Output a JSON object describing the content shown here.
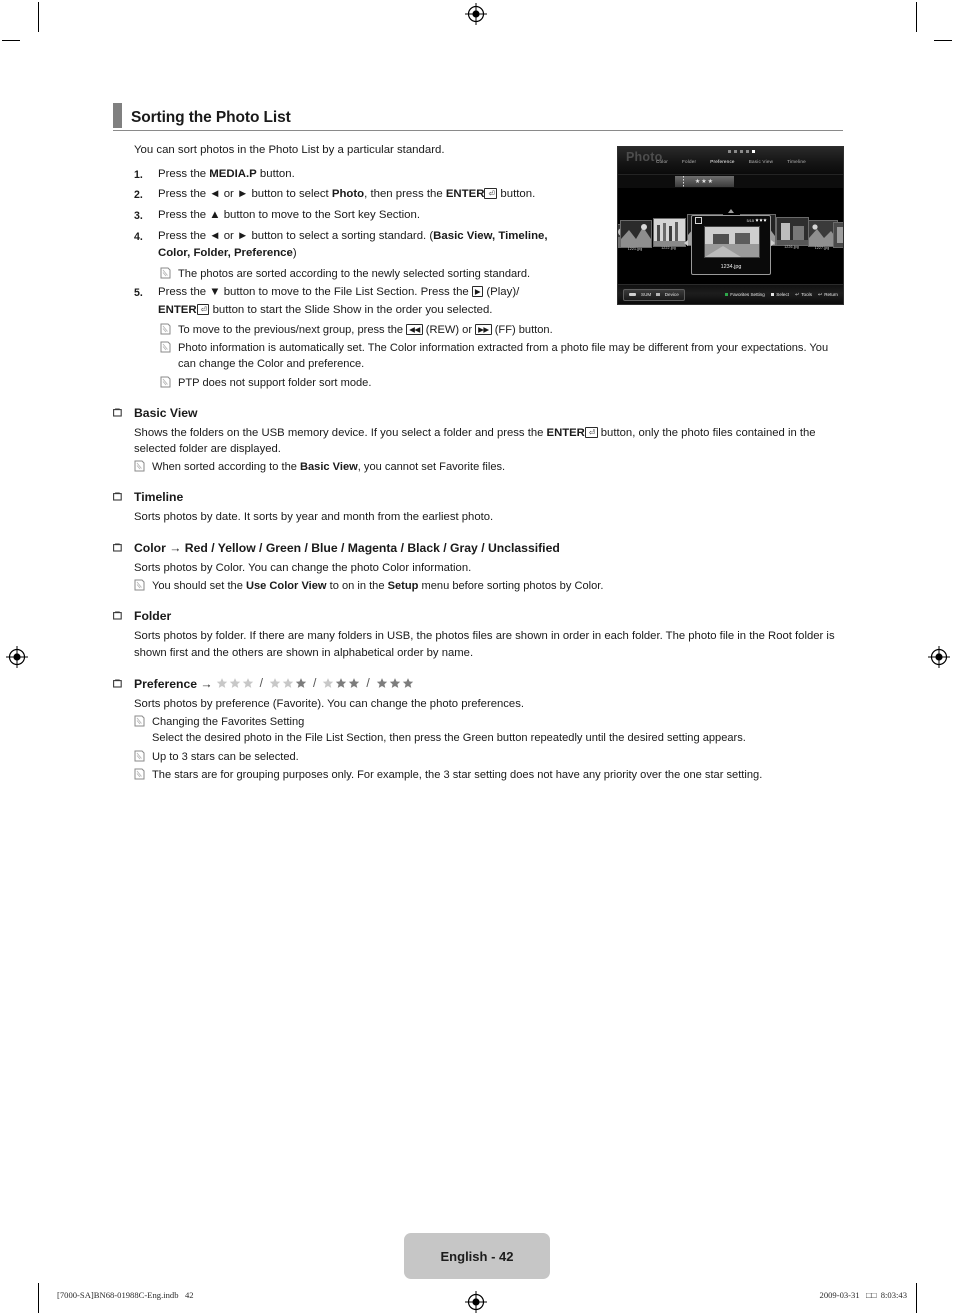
{
  "section": {
    "title": "Sorting the Photo List",
    "intro": "You can sort photos in the Photo List by a particular standard."
  },
  "steps": [
    {
      "num": "1.",
      "text_before": "Press the ",
      "bold": "MEDIA.P",
      "text_after": " button."
    },
    {
      "num": "2.",
      "text": "Press the ◄ or ► button to select Photo, then press the ENTER button."
    },
    {
      "num": "3.",
      "text": "Press the ▲ button to move to the Sort key Section."
    },
    {
      "num": "4.",
      "text": "Press the ◄ or ► button to select a sorting standard. (Basic View, Timeline, Color, Folder, Preference)"
    },
    {
      "num": "5.",
      "text": "Press the ▼ button to move to the File List Section. Press the (Play)/ENTER button to start the Slide Show in the order you selected."
    }
  ],
  "step_parts": {
    "s2_a": "Press the ◄ or ► button to select ",
    "s2_bold": "Photo",
    "s2_b": ", then press the ",
    "s2_enter": "ENTER",
    "s2_c": " button.",
    "s3": "Press the ▲ button to move to the Sort key Section.",
    "s4_a": "Press the ◄ or ► button to select a sorting standard. (",
    "s4_bold1": "Basic View, Timeline,",
    "s4_bold2": "Color, Folder, Preference",
    "s4_c": ")",
    "s5_a": "Press the ▼ button to move to the File List Section. Press the ",
    "s5_play": " (Play)/",
    "s5_enter": "ENTER",
    "s5_b": " button to start the Slide Show in the order you selected."
  },
  "notes": {
    "n_sorted": "The photos are sorted according to the newly selected sorting standard.",
    "n_group_a": "To move to the previous/next group, press the ",
    "n_group_rew": " (REW) or ",
    "n_group_ff": " (FF) button.",
    "n_photoinfo": "Photo information is automatically set. The Color information extracted from a photo file may be different from your expectations. You can change the Color and preference.",
    "n_ptp": "PTP does not support folder sort mode."
  },
  "subsections": [
    {
      "id": "basic-view",
      "title": "Basic View",
      "body_a": "Shows the folders on the USB memory device. If you select a folder and press the ",
      "body_enter": "ENTER",
      "body_b": " button, only the photo files contained in the selected folder are displayed.",
      "note_a": "When sorted according to the ",
      "note_bold": "Basic View",
      "note_b": ", you cannot set Favorite files."
    },
    {
      "id": "timeline",
      "title": "Timeline",
      "body": "Sorts photos by date. It sorts by year and month from the earliest photo."
    },
    {
      "id": "color",
      "title": "Color → Red / Yellow / Green / Blue / Magenta / Black / Gray / Unclassified",
      "body": "Sorts photos by Color. You can change the photo Color information.",
      "note_a": "You should set the ",
      "note_bold1": "Use Color View",
      "note_b": " to on in the ",
      "note_bold2": "Setup",
      "note_c": " menu before sorting photos by Color."
    },
    {
      "id": "folder",
      "title": "Folder",
      "body": "Sorts photos by folder. If there are many folders in USB, the photos files are shown in order in each folder. The photo file in the Root folder is shown first and the others are shown in alphabetical order by name."
    },
    {
      "id": "preference",
      "title": "Preference →",
      "body": "Sorts photos by preference (Favorite). You can change the photo preferences.",
      "note1": "Changing the Favorites Setting",
      "note1_sub": "Select the desired photo in the File List Section, then press the Green button repeatedly until the desired setting appears.",
      "note2": "Up to 3 stars can be selected.",
      "note3": "The stars are for grouping purposes only. For example, the 3 star setting does not have any priority over the one star setting."
    }
  ],
  "preference_stars": {
    "groups": [
      {
        "filled": 0,
        "total": 3
      },
      {
        "filled": 1,
        "total": 3
      },
      {
        "filled": 2,
        "total": 3
      },
      {
        "filled": 3,
        "total": 3
      }
    ],
    "separator": "/",
    "empty_color": "#c8c8c8",
    "filled_color": "#7d7d7d"
  },
  "tv_screenshot": {
    "app_title": "Photo",
    "menu": [
      {
        "label": "Color",
        "selected": false
      },
      {
        "label": "Folder",
        "selected": false
      },
      {
        "label": "Preference",
        "selected": true
      },
      {
        "label": "Basic View",
        "selected": false
      },
      {
        "label": "Timeline",
        "selected": false
      }
    ],
    "page_dots": {
      "count": 5,
      "active_index": 4
    },
    "sort_chip_stars": "★★★",
    "selected_item": {
      "filename": "1234.jpg",
      "counter": "5/15",
      "stars": 3
    },
    "thumbnails_left": [
      {
        "label": "1221.jpg"
      },
      {
        "label": "1222.jpg"
      },
      {
        "label": "1223.jpg"
      }
    ],
    "thumbnails_right": [
      {
        "label": "1225.jpg"
      },
      {
        "label": "1226.jpg"
      },
      {
        "label": "1227.jpg"
      }
    ],
    "device_chip": {
      "name": "SUM",
      "label": "Device"
    },
    "hints": [
      {
        "label": "Favorites Setting",
        "color": "#2ea84a"
      },
      {
        "label": "Select",
        "color": "#e4e4e4"
      },
      {
        "label": "Tools",
        "color": "#e4e4e4"
      },
      {
        "label": "Return",
        "color": "#e4e4e4"
      }
    ]
  },
  "footer": {
    "page_label": "English - 42",
    "print_left": "[7000-SA]BN68-01988C-Eng.indb   42",
    "print_right": "2009-03-31   □□  8:03:43"
  }
}
